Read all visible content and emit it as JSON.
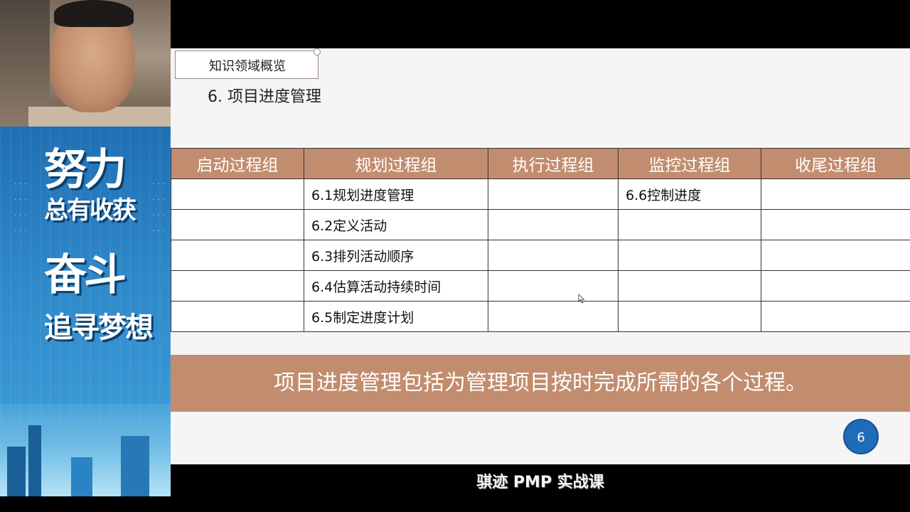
{
  "slide": {
    "section_tab": "知识领域概览",
    "title": "6.   项目进度管理",
    "table": {
      "headers": [
        "启动过程组",
        "规划过程组",
        "执行过程组",
        "监控过程组",
        "收尾过程组"
      ],
      "rows": [
        [
          "",
          "6.1规划进度管理",
          "",
          "6.6控制进度",
          ""
        ],
        [
          "",
          "6.2定义活动",
          "",
          "",
          ""
        ],
        [
          "",
          "6.3排列活动顺序",
          "",
          "",
          ""
        ],
        [
          "",
          "6.4估算活动持续时间",
          "",
          "",
          ""
        ],
        [
          "",
          "6.5制定进度计划",
          "",
          "",
          ""
        ]
      ]
    },
    "summary": "项目进度管理包括为管理项目按时完成所需的各个过程。",
    "page_number": "6"
  },
  "poster": {
    "line1": "努力",
    "line2": "总有收获",
    "line3": "奋斗",
    "line4": "追寻梦想"
  },
  "footer": {
    "caption": "骐迹 PMP 实战课"
  },
  "colors": {
    "accent": "#c28d6e",
    "page_badge": "#1f6cb8",
    "slide_bg": "#f4f5f4"
  }
}
